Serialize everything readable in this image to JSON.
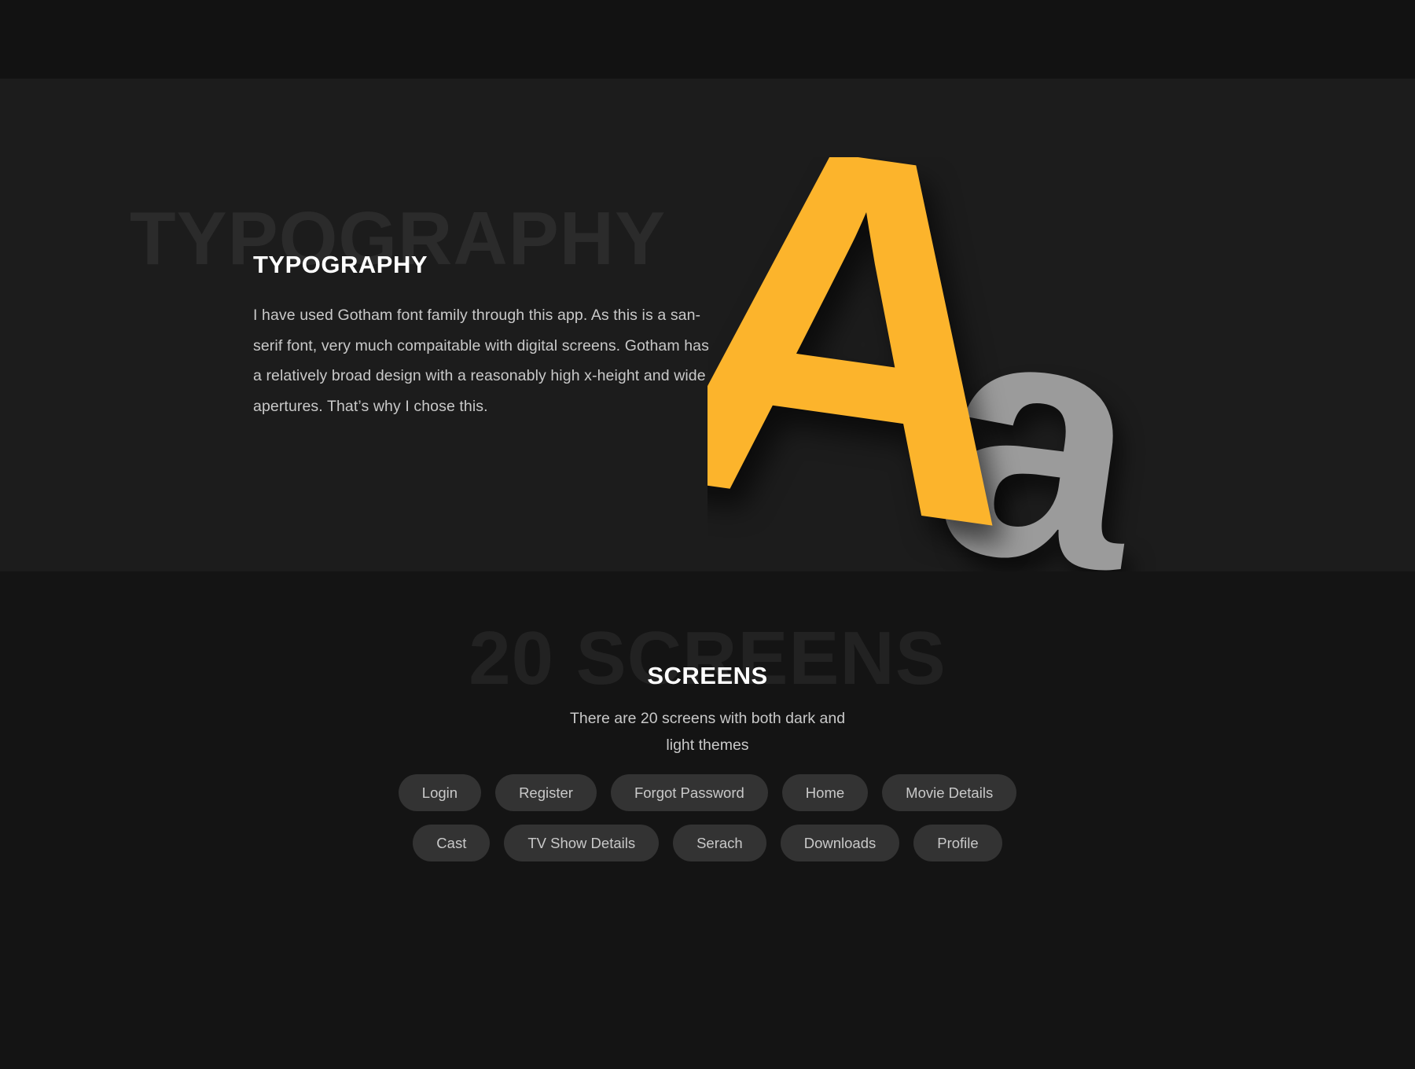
{
  "topbar": {
    "label": ""
  },
  "typography": {
    "watermark": "TYPOGRAPHY",
    "heading": "TYPOGRAPHY",
    "body": "I have used Gotham font family through this app. As this is a san-serif font, very much compaitable with digital screens. Gotham has a relatively broad design with a reasonably high x-height and wide apertures. That’s why I chose this.",
    "specimen": {
      "uppercase_glyph": "A",
      "lowercase_glyph": "a",
      "uppercase_color": "#fcb42c",
      "lowercase_color": "#9b9b9b"
    }
  },
  "screens": {
    "watermark": "20 SCREENS",
    "heading": "SCREENS",
    "subtitle_line1": "There are 20 screens with both dark and",
    "subtitle_line2": "light themes",
    "rows": [
      [
        {
          "label": "Login"
        },
        {
          "label": "Register"
        },
        {
          "label": "Forgot Password"
        },
        {
          "label": "Home"
        },
        {
          "label": "Movie Details"
        }
      ],
      [
        {
          "label": "Cast"
        },
        {
          "label": "TV Show Details"
        },
        {
          "label": "Serach"
        },
        {
          "label": "Downloads"
        },
        {
          "label": "Profile"
        }
      ]
    ]
  },
  "colors": {
    "topbar_bg": "#121212",
    "typography_bg": "#1c1c1c",
    "screens_bg": "#141414",
    "watermark_typography": "#2b2b2b",
    "watermark_screens": "#222222",
    "accent": "#fcb42c",
    "pill_bg": "#333333",
    "pill_text": "#c9c9c9",
    "heading_text": "#ffffff",
    "body_text": "#c9c9c9"
  }
}
